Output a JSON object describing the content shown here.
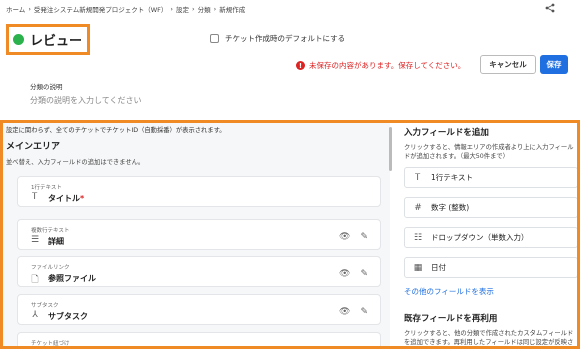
{
  "breadcrumb": [
    "ホーム",
    "›",
    "受発注システム新規開発プロジェクト（WF）",
    "›",
    "設定",
    "›",
    "分類",
    "›",
    "新規作成"
  ],
  "header": {
    "status_color": "#2bb24c",
    "title": "レビュー",
    "default_checkbox_label": "チケット作成時のデフォルトにする",
    "unsaved_warning": "未保存の内容があります。保存してください。",
    "cancel_label": "キャンセル",
    "save_label": "保存"
  },
  "description": {
    "label": "分類の説明",
    "placeholder": "分類の説明を入力してください"
  },
  "main_area": {
    "note_top": "設定に関わらず、全てのチケットでチケットID（自動採番）が表示されます。",
    "title": "メインエリア",
    "note": "並べ替え、入力フィールドの追加はできません。",
    "cards": [
      {
        "type_label": "1行テキスト",
        "name": "タイトル",
        "required": "*",
        "icon": "text-t-icon"
      },
      {
        "type_label": "複数行テキスト",
        "name": "詳細",
        "icon": "lines-icon"
      },
      {
        "type_label": "ファイルリンク",
        "name": "参照ファイル",
        "icon": "file-link-icon"
      },
      {
        "type_label": "サブタスク",
        "name": "サブタスク",
        "icon": "subtask-icon"
      },
      {
        "type_label": "チケット紐づけ",
        "name": "",
        "icon": "link-icon"
      }
    ]
  },
  "add_panel": {
    "title": "入力フィールドを追加",
    "desc": "クリックすると、情報エリアの作成者より上に入力フィールドが追加されます。（最大50件まで）",
    "fields": [
      {
        "label": "1行テキスト",
        "icon": "text-t-icon"
      },
      {
        "label": "数字 (整数)",
        "icon": "hash-icon"
      },
      {
        "label": "ドロップダウン（単数入力）",
        "icon": "list-icon"
      },
      {
        "label": "日付",
        "icon": "calendar-icon"
      }
    ],
    "more_link": "その他のフィールドを表示",
    "reuse_title": "既存フィールドを再利用",
    "reuse_desc": "クリックすると、他の分類で作成されたカスタムフィールドを追加できます。再利用したフィールドは同じ設定が反映されます。"
  }
}
